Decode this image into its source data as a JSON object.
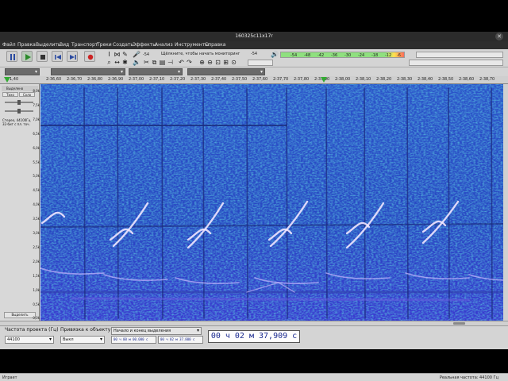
{
  "window": {
    "title": "160325c11x17r",
    "close_icon": "close-icon"
  },
  "menu": [
    "Файл",
    "Правка",
    "Выделить",
    "Вид",
    "Транспорт",
    "Треки",
    "Создать",
    "Эффекты",
    "Анализ",
    "Инструменты",
    "Справка"
  ],
  "toolbar": {
    "monitor_prompt": "Щёлкните, чтобы начать мониторинг",
    "rec_level_left": "-54",
    "rec_meter_ticks": [
      "-54",
      "-48",
      "-42",
      "-36",
      "-30",
      "-24",
      "-18",
      "-12",
      "-6"
    ],
    "play_meter_left": "-54"
  },
  "ruler": {
    "labels": [
      "1,40",
      "2:36,60",
      "2:36,70",
      "2:36,80",
      "2:36,90",
      "2:37,00",
      "2:37,10",
      "2:37,20",
      "2:37,30",
      "2:37,40",
      "2:37,50",
      "2:37,60",
      "2:37,70",
      "2:37,80",
      "2:37,90",
      "2:38,00",
      "2:38,10",
      "2:38,20",
      "2:38,30",
      "2:38,40",
      "2:38,50",
      "2:38,60",
      "2:38,70"
    ]
  },
  "track": {
    "name": "Выделено",
    "mute_label": "Тихо",
    "solo_label": "Соло",
    "info_line1": "Стерео, 44100Гц",
    "info_line2": "32-бит с пл. точ.",
    "select_button": "Выделить"
  },
  "freq_scale": [
    "8,0k",
    "7,5k",
    "7,0k",
    "6,5k",
    "6,0k",
    "5,5k",
    "5,0k",
    "4,5k",
    "4,0k",
    "3,5k",
    "3,0k",
    "2,5k",
    "2,0k",
    "1,5k",
    "1,0k",
    "0,5k",
    "0,0k"
  ],
  "bottom": {
    "rate_label": "Частота проекта (Гц)",
    "rate_value": "44100",
    "snap_label": "Привязка к объекту",
    "snap_value": "Выкл",
    "selection_mode": "Начало и конец выделения",
    "sel_start": "00 ч 00 м 00.000 с",
    "sel_end": "00 ч 02 м 37.800 с",
    "audio_position": "00 ч 02 м 37,909 с"
  },
  "status": {
    "left": "Играет",
    "right": "Реальная частота: 44100 Гц"
  },
  "colors": {
    "spectro_bg": "#2a4bc8",
    "spectro_hi": "#30d0b0",
    "call_color": "#f0e6ff"
  }
}
